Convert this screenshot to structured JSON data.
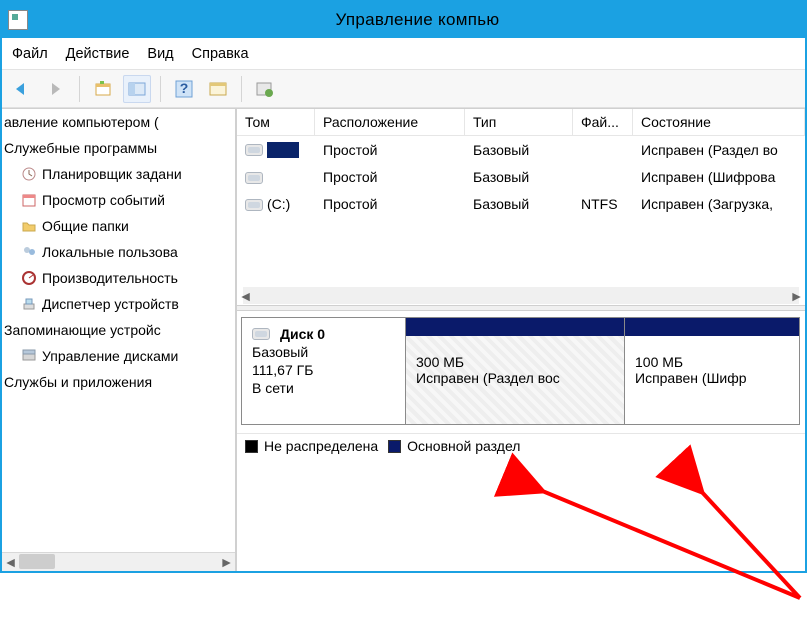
{
  "window": {
    "title": "Управление компью"
  },
  "menu": {
    "file": "Файл",
    "action": "Действие",
    "view": "Вид",
    "help": "Справка"
  },
  "nav": {
    "root": "авление компьютером (",
    "tools_group": "Служебные программы",
    "scheduler": "Планировщик задани",
    "events": "Просмотр событий",
    "shared": "Общие папки",
    "users": "Локальные пользова",
    "perf": "Производительность",
    "devmgr": "Диспетчер устройств",
    "storage_group": "Запоминающие устройс",
    "diskmgmt": "Управление дисками",
    "services_group": "Службы и приложения"
  },
  "columns": {
    "volume": "Том",
    "layout": "Расположение",
    "type": "Тип",
    "fs": "Фай...",
    "status": "Состояние"
  },
  "rows": [
    {
      "vol": "",
      "layout": "Простой",
      "type": "Базовый",
      "fs": "",
      "status": "Исправен (Раздел во",
      "selected": true
    },
    {
      "vol": "",
      "layout": "Простой",
      "type": "Базовый",
      "fs": "",
      "status": "Исправен (Шифрова"
    },
    {
      "vol": "(C:)",
      "layout": "Простой",
      "type": "Базовый",
      "fs": "NTFS",
      "status": "Исправен (Загрузка,"
    }
  ],
  "disk": {
    "name": "Диск 0",
    "type": "Базовый",
    "size": "111,67 ГБ",
    "state": "В сети"
  },
  "partitions": [
    {
      "size": "300 МБ",
      "status": "Исправен (Раздел вос"
    },
    {
      "size": "100 МБ",
      "status": "Исправен (Шифр"
    }
  ],
  "legend": {
    "unalloc": "Не распределена",
    "primary": "Основной раздел"
  }
}
